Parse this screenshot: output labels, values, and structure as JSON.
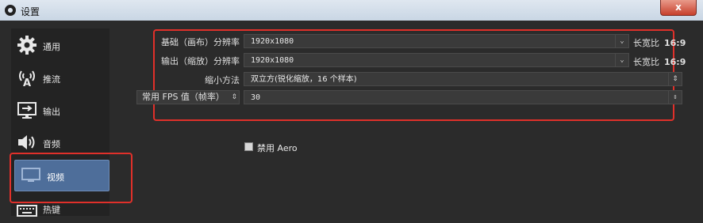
{
  "window": {
    "title": "设置",
    "close_label": "x"
  },
  "sidebar": {
    "items": [
      {
        "label": "通用",
        "icon": "gear-icon"
      },
      {
        "label": "推流",
        "icon": "antenna-icon"
      },
      {
        "label": "输出",
        "icon": "output-icon"
      },
      {
        "label": "音频",
        "icon": "speaker-icon"
      },
      {
        "label": "视频",
        "icon": "monitor-icon",
        "active": true
      },
      {
        "label": "热键",
        "icon": "keyboard-icon"
      }
    ]
  },
  "video": {
    "base_resolution": {
      "label": "基础（画布）分辨率",
      "value": "1920x1080",
      "ratio_label": "长宽比",
      "ratio_value": "16:9"
    },
    "output_resolution": {
      "label": "输出（缩放）分辨率",
      "value": "1920x1080",
      "ratio_label": "长宽比",
      "ratio_value": "16:9"
    },
    "downscale_filter": {
      "label": "缩小方法",
      "value": "双立方(锐化缩放，16 个样本)"
    },
    "fps": {
      "label": "常用 FPS 值（帧率）",
      "value": "30"
    },
    "disable_aero": {
      "label": "禁用 Aero",
      "checked": false
    }
  },
  "colors": {
    "highlight_box": "#e0302a",
    "active_item": "#4e6e9a"
  }
}
